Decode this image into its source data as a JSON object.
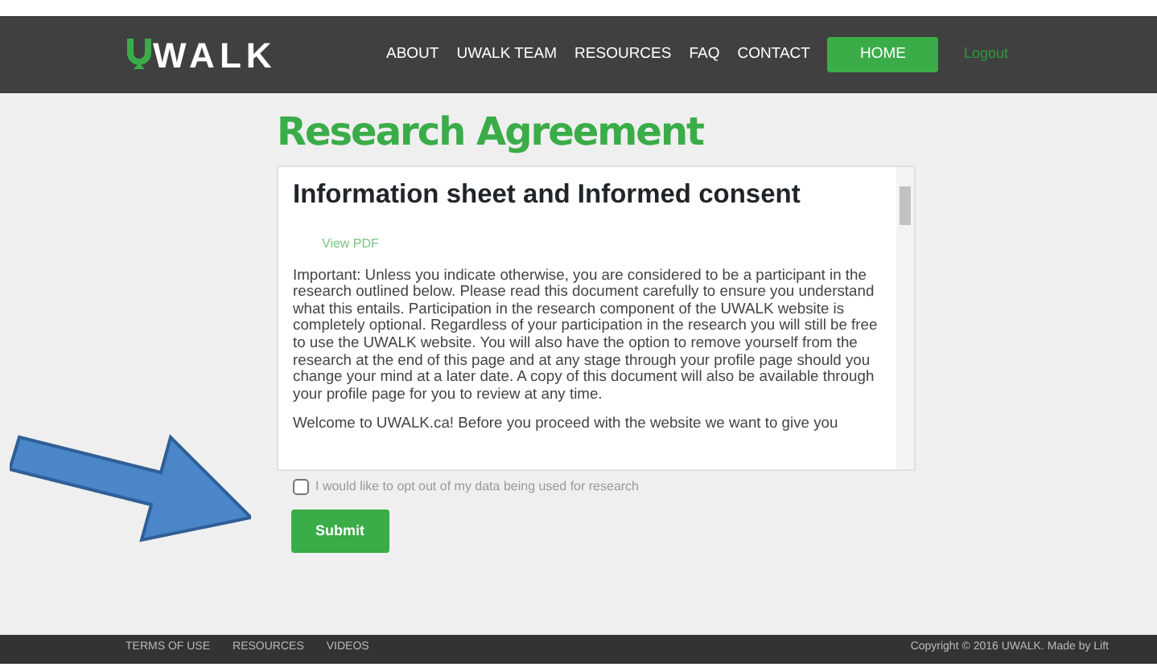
{
  "logo": {
    "text": "WALK"
  },
  "nav": [
    {
      "label": "ABOUT",
      "selected": false
    },
    {
      "label": "UWALK TEAM",
      "selected": false
    },
    {
      "label": "RESOURCES",
      "selected": false
    },
    {
      "label": "FAQ",
      "selected": false
    },
    {
      "label": "CONTACT",
      "selected": false
    },
    {
      "label": "HOME",
      "selected": true
    }
  ],
  "logout": "Logout",
  "title": "Research Agreement",
  "document": {
    "heading": "Information sheet and Informed consent",
    "link": "View PDF",
    "paragraphs": [
      "Important: Unless you indicate otherwise, you are considered to be a participant in the research outlined below. Please read this document carefully to ensure you understand what this entails. Participation in the research component of the UWALK website is completely optional. Regardless of your participation in the research you will still be free to use the UWALK website. You will also have the option to remove yourself from the research at the end of this page and at any stage through your profile page should you change your mind at a later date. A copy of this document will also be available through your profile page for you to review at any time.",
      "Welcome to UWALK.ca! Before you proceed with the website we want to give you"
    ]
  },
  "opt_out": {
    "label": "I would like to opt out of my data being used for research",
    "checked": false
  },
  "submit": "Submit",
  "footer": {
    "links": [
      "TERMS OF USE",
      "RESOURCES",
      "VIDEOS"
    ],
    "copyright": "Copyright © 2016 UWALK. Made by Lift"
  }
}
